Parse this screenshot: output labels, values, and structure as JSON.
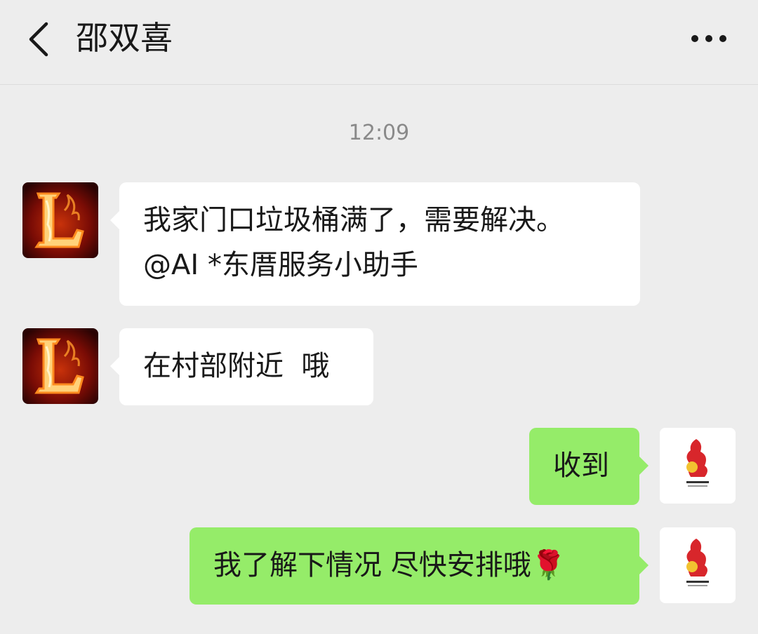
{
  "header": {
    "title": "邵双喜",
    "back_icon": "chevron-left-icon",
    "more_icon": "more-dots-icon"
  },
  "timestamp": "12:09",
  "messages": [
    {
      "side": "in",
      "lines": [
        "我家门口垃圾桶满了，需要解决。",
        "@AI *东厝服务小助手"
      ]
    },
    {
      "side": "in",
      "lines": [
        "在村部附近  哦"
      ]
    },
    {
      "side": "out",
      "lines": [
        "收到"
      ]
    },
    {
      "side": "out",
      "lines": [
        "我了解下情况 尽快安排哦"
      ],
      "emoji": "🌹"
    }
  ],
  "colors": {
    "background": "#ededed",
    "incoming_bubble": "#ffffff",
    "outgoing_bubble": "#95ec69"
  }
}
